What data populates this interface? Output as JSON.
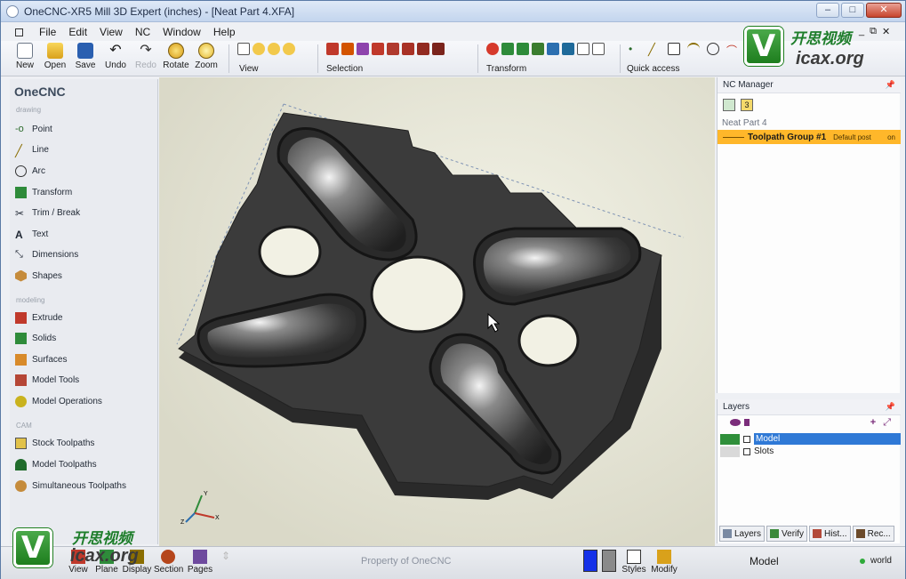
{
  "window": {
    "title": "OneCNC-XR5 Mill 3D Expert (inches) - [Neat Part 4.XFA]",
    "controls": [
      "–",
      "□",
      "✕"
    ],
    "mdi_controls": [
      "_",
      "⧉",
      "✕"
    ]
  },
  "menu": [
    "File",
    "Edit",
    "View",
    "NC",
    "Window",
    "Help"
  ],
  "toolbar": {
    "buttons": [
      {
        "label": "New",
        "icon": "new-icon"
      },
      {
        "label": "Open",
        "icon": "open-icon"
      },
      {
        "label": "Save",
        "icon": "save-icon"
      },
      {
        "label": "Undo",
        "icon": "undo-icon"
      },
      {
        "label": "Redo",
        "icon": "redo-icon",
        "disabled": true
      },
      {
        "label": "Rotate",
        "icon": "rotate-icon"
      },
      {
        "label": "Zoom",
        "icon": "zoom-icon"
      }
    ],
    "groups": {
      "view": "View",
      "selection": "Selection",
      "transform": "Transform",
      "quick_access": "Quick access"
    }
  },
  "left_panel": {
    "brand": "OneCNC",
    "sections": {
      "drawing": "drawing",
      "modeling": "modeling",
      "cam": "CAM"
    },
    "drawing_items": [
      "Point",
      "Line",
      "Arc",
      "Transform",
      "Trim / Break",
      "Text",
      "Dimensions",
      "Shapes"
    ],
    "modeling_items": [
      "Extrude",
      "Solids",
      "Surfaces",
      "Model Tools",
      "Model Operations"
    ],
    "cam_items": [
      "Stock Toolpaths",
      "Model Toolpaths",
      "Simultaneous Toolpaths"
    ]
  },
  "nc_manager": {
    "title": "NC Manager",
    "count_badge": "3",
    "part_name": "Neat Part 4",
    "toolpath_group": "Toolpath Group #1",
    "post": "Default post",
    "status": "on"
  },
  "layers": {
    "title": "Layers",
    "items": [
      {
        "name": "Model",
        "selected": true
      },
      {
        "name": "Slots",
        "selected": false
      }
    ]
  },
  "panel_tabs": [
    "Layers",
    "Verify",
    "Hist...",
    "Rec..."
  ],
  "statusbar": {
    "buttons": [
      "View",
      "Plane",
      "Display",
      "Section",
      "Pages"
    ],
    "property_text": "Property of OneCNC",
    "right_buttons": [
      "Styles",
      "Modify"
    ],
    "mode": "Model",
    "coord_system": "world"
  },
  "viewport": {
    "axes": {
      "x": "X",
      "y": "Y",
      "z": "Z"
    }
  },
  "watermark": {
    "letter": "V",
    "cn_text": "开思视频",
    "domain": "icax.org"
  },
  "colors": {
    "selection_highlight": "#ffb72a",
    "layer_highlight": "#2f79d6",
    "part_body": "#3a3a3a"
  }
}
